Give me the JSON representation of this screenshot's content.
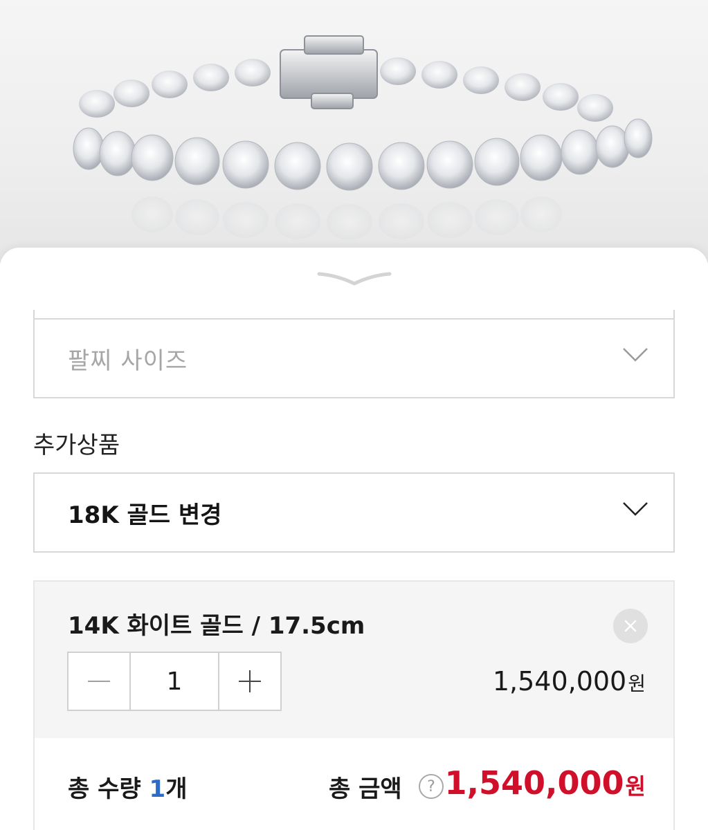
{
  "product_image": {
    "alt_icon": "diamond-tennis-bracelet-photo"
  },
  "options": {
    "size_select": {
      "placeholder": "팔찌 사이즈"
    },
    "addon_title": "추가상품",
    "addon_select": {
      "value": "18K 골드 변경"
    }
  },
  "selected_item": {
    "name": "14K 화이트 골드 / 17.5cm",
    "quantity": "1",
    "price": "1,540,000",
    "price_unit": "원"
  },
  "totals": {
    "qty_label": "총 수량",
    "qty_value": "1",
    "qty_unit": "개",
    "amount_label": "총 금액",
    "help_symbol": "?",
    "amount": "1,540,000",
    "amount_unit": "원"
  },
  "colors": {
    "accent_red": "#d0102b",
    "accent_blue": "#2d6bc9"
  }
}
